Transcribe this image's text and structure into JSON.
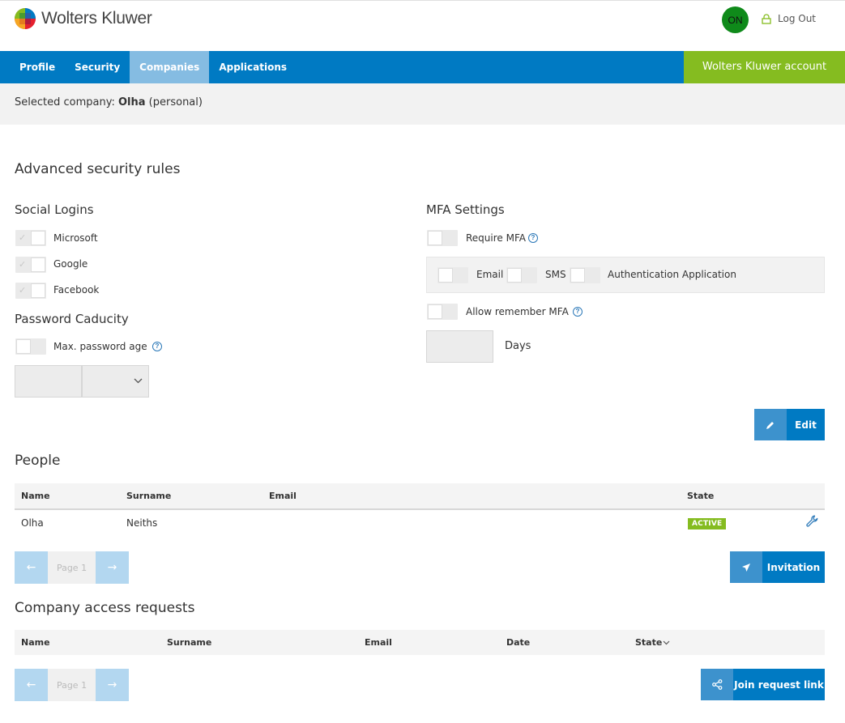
{
  "header": {
    "logo_text": "Wolters Kluwer",
    "avatar_initials": "ON",
    "logout_label": "Log Out"
  },
  "nav": {
    "tabs": [
      {
        "label": "Profile"
      },
      {
        "label": "Security"
      },
      {
        "label": "Companies"
      },
      {
        "label": "Applications"
      }
    ],
    "active_tab": "Companies",
    "account_label": "Wolters Kluwer account"
  },
  "company_bar": {
    "prefix": "Selected company:",
    "name": "Olha",
    "suffix": "(personal)"
  },
  "security": {
    "title": "Advanced security rules",
    "social_logins": {
      "title": "Social Logins",
      "items": [
        {
          "label": "Microsoft"
        },
        {
          "label": "Google"
        },
        {
          "label": "Facebook"
        }
      ]
    },
    "password_caducity": {
      "title": "Password Caducity",
      "max_age_label": "Max. password age"
    },
    "mfa": {
      "title": "MFA Settings",
      "require_label": "Require MFA",
      "email_label": "Email",
      "sms_label": "SMS",
      "auth_app_label": "Authentication Application",
      "remember_label": "Allow remember MFA",
      "days_label": "Days"
    },
    "edit_label": "Edit"
  },
  "people": {
    "title": "People",
    "columns": [
      "Name",
      "Surname",
      "Email",
      "State"
    ],
    "rows": [
      {
        "name": "Olha",
        "surname": "Neiths",
        "email": "",
        "state": "ACTIVE"
      }
    ],
    "page_label": "Page 1",
    "invitation_label": "Invitation"
  },
  "requests": {
    "title": "Company access requests",
    "columns": [
      "Name",
      "Surname",
      "Email",
      "Date",
      "State"
    ],
    "page_label": "Page 1",
    "join_label": "Join request link"
  },
  "colors": {
    "brand_blue": "#007ac3",
    "active_tab": "#85bce2",
    "brand_green": "#85bc20",
    "avatar_green": "#0f8a1a"
  }
}
